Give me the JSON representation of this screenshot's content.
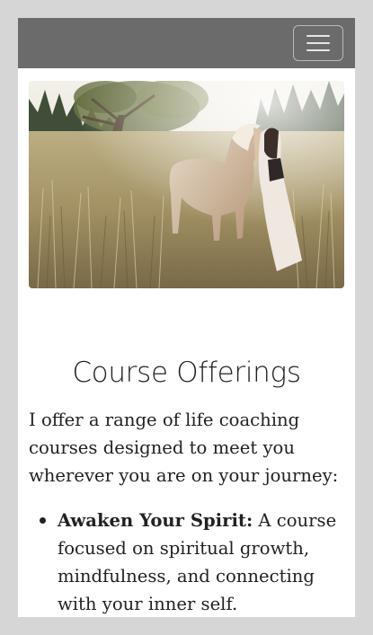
{
  "navbar": {
    "background_color": "#6b6b6b",
    "menu_toggle_icon": "hamburger-menu-icon"
  },
  "hero_image": {
    "subject": "photo"
  },
  "content": {
    "heading": "Course Offerings",
    "intro": "I offer a range of life coaching courses designed to meet you wherever you are on your journey:",
    "courses": [
      {
        "name": "Awaken Your Spirit",
        "separator": ":",
        "description": " A course focused on spiritual growth, mindfulness, and connecting with your inner self."
      }
    ]
  }
}
